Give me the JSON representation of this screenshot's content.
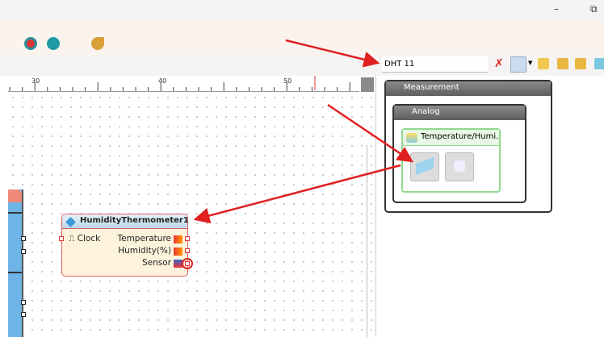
{
  "window": {
    "minimize": "–",
    "restore": "⧉"
  },
  "search": {
    "value": "DHT 11"
  },
  "ruler": {
    "ticks": [
      "30",
      "40",
      "50"
    ]
  },
  "palette": {
    "group": "Measurement",
    "subgroup": "Analog",
    "category": "Temperature/Humi...",
    "items": [
      "humidity-thermometer-component",
      "dht-sensor-component"
    ]
  },
  "component": {
    "title": "HumidityThermometer1",
    "inputs": [
      "Clock"
    ],
    "outputs": [
      "Temperature",
      "Humidity(%)",
      "Sensor"
    ]
  },
  "colors": {
    "arrow": "#e02020",
    "accent": "#4fa3dc"
  }
}
